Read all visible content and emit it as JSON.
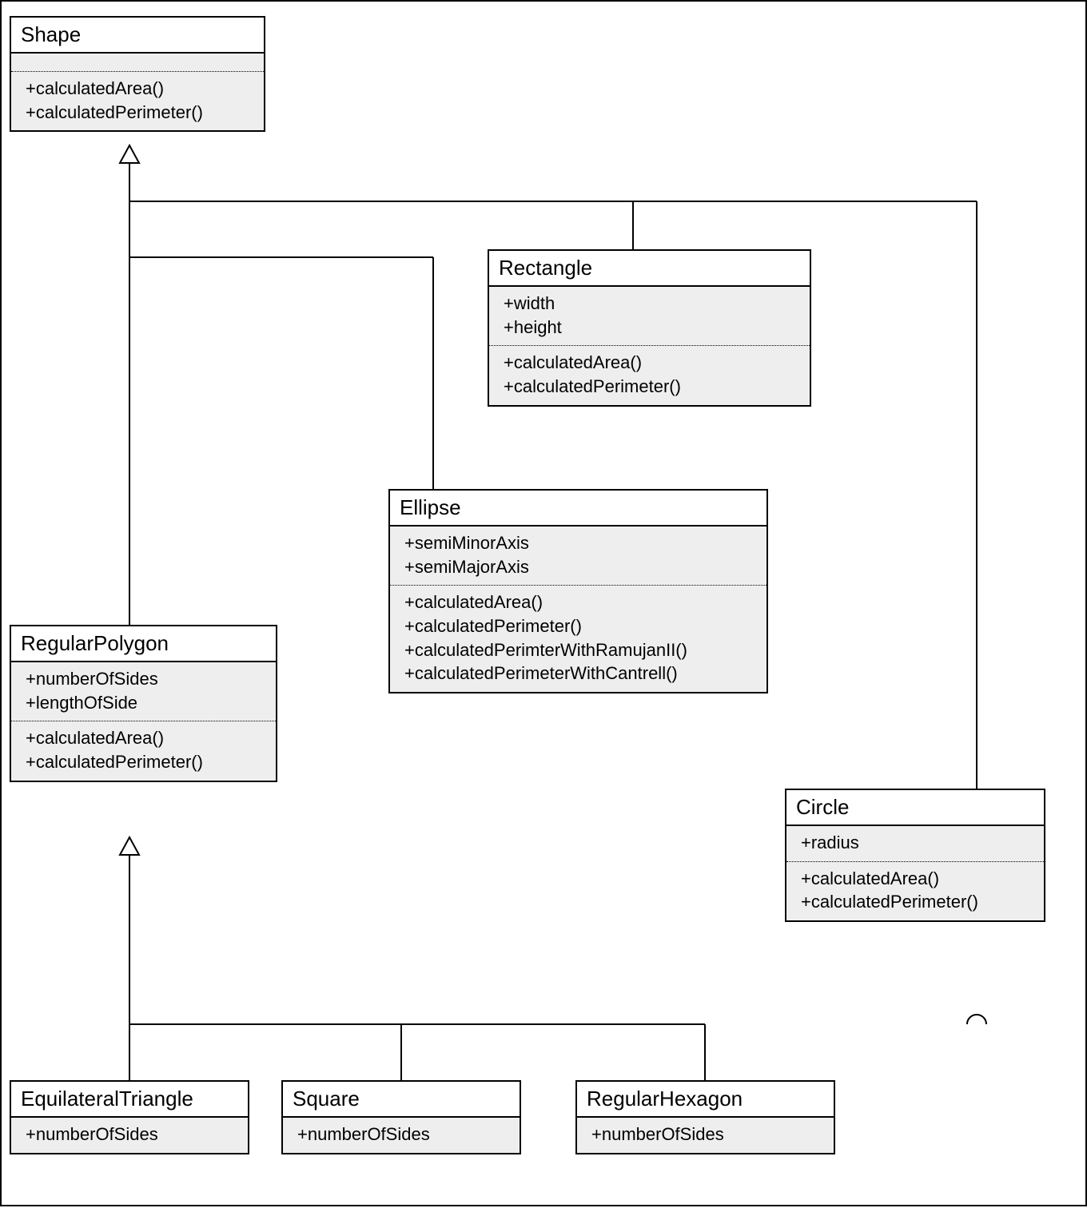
{
  "shape": {
    "name": "Shape",
    "methods": [
      "+calculatedArea()",
      "+calculatedPerimeter()"
    ]
  },
  "rectangle": {
    "name": "Rectangle",
    "attrs": [
      "+width",
      "+height"
    ],
    "methods": [
      "+calculatedArea()",
      "+calculatedPerimeter()"
    ]
  },
  "ellipse": {
    "name": "Ellipse",
    "attrs": [
      "+semiMinorAxis",
      "+semiMajorAxis"
    ],
    "methods": [
      "+calculatedArea()",
      "+calculatedPerimeter()",
      "+calculatedPerimterWithRamujanII()",
      "+calculatedPerimeterWithCantrell()"
    ]
  },
  "regularpolygon": {
    "name": "RegularPolygon",
    "attrs": [
      "+numberOfSides",
      "+lengthOfSide"
    ],
    "methods": [
      "+calculatedArea()",
      "+calculatedPerimeter()"
    ]
  },
  "circle": {
    "name": "Circle",
    "attrs": [
      "+radius"
    ],
    "methods": [
      "+calculatedArea()",
      "+calculatedPerimeter()"
    ]
  },
  "equilateraltriangle": {
    "name": "EquilateralTriangle",
    "attrs": [
      "+numberOfSides"
    ]
  },
  "square": {
    "name": "Square",
    "attrs": [
      "+numberOfSides"
    ]
  },
  "regularhexagon": {
    "name": "RegularHexagon",
    "attrs": [
      "+numberOfSides"
    ]
  }
}
